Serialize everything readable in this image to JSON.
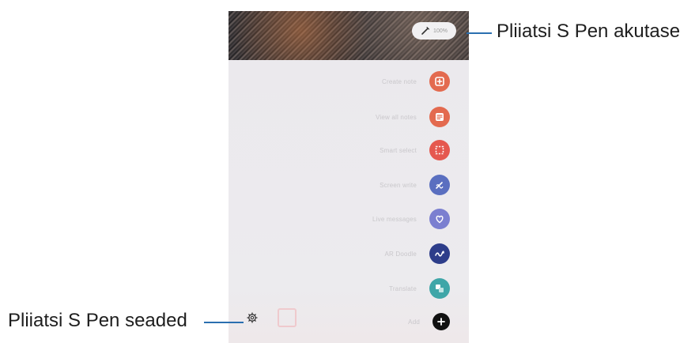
{
  "callouts": {
    "battery": "Pliiatsi S Pen akutase",
    "settings": "Pliiatsi S Pen seaded"
  },
  "battery_pill": {
    "value": "100%"
  },
  "menu": {
    "items": [
      {
        "label": "Create note",
        "icon": "create-note-icon",
        "color": "#e36a4f"
      },
      {
        "label": "View all notes",
        "icon": "view-notes-icon",
        "color": "#e36a4f"
      },
      {
        "label": "Smart select",
        "icon": "smart-select-icon",
        "color": "#e5584f"
      },
      {
        "label": "Screen write",
        "icon": "screen-write-icon",
        "color": "#5a6fc0"
      },
      {
        "label": "Live messages",
        "icon": "live-messages-icon",
        "color": "#7b7fd0"
      },
      {
        "label": "AR Doodle",
        "icon": "ar-doodle-icon",
        "color": "#2d3d8a"
      },
      {
        "label": "Translate",
        "icon": "translate-icon",
        "color": "#3fa6a8"
      },
      {
        "label": "Add",
        "icon": "add-icon",
        "color": "#111111"
      }
    ]
  },
  "colors": {
    "callout_line": "#2a6fb0"
  }
}
